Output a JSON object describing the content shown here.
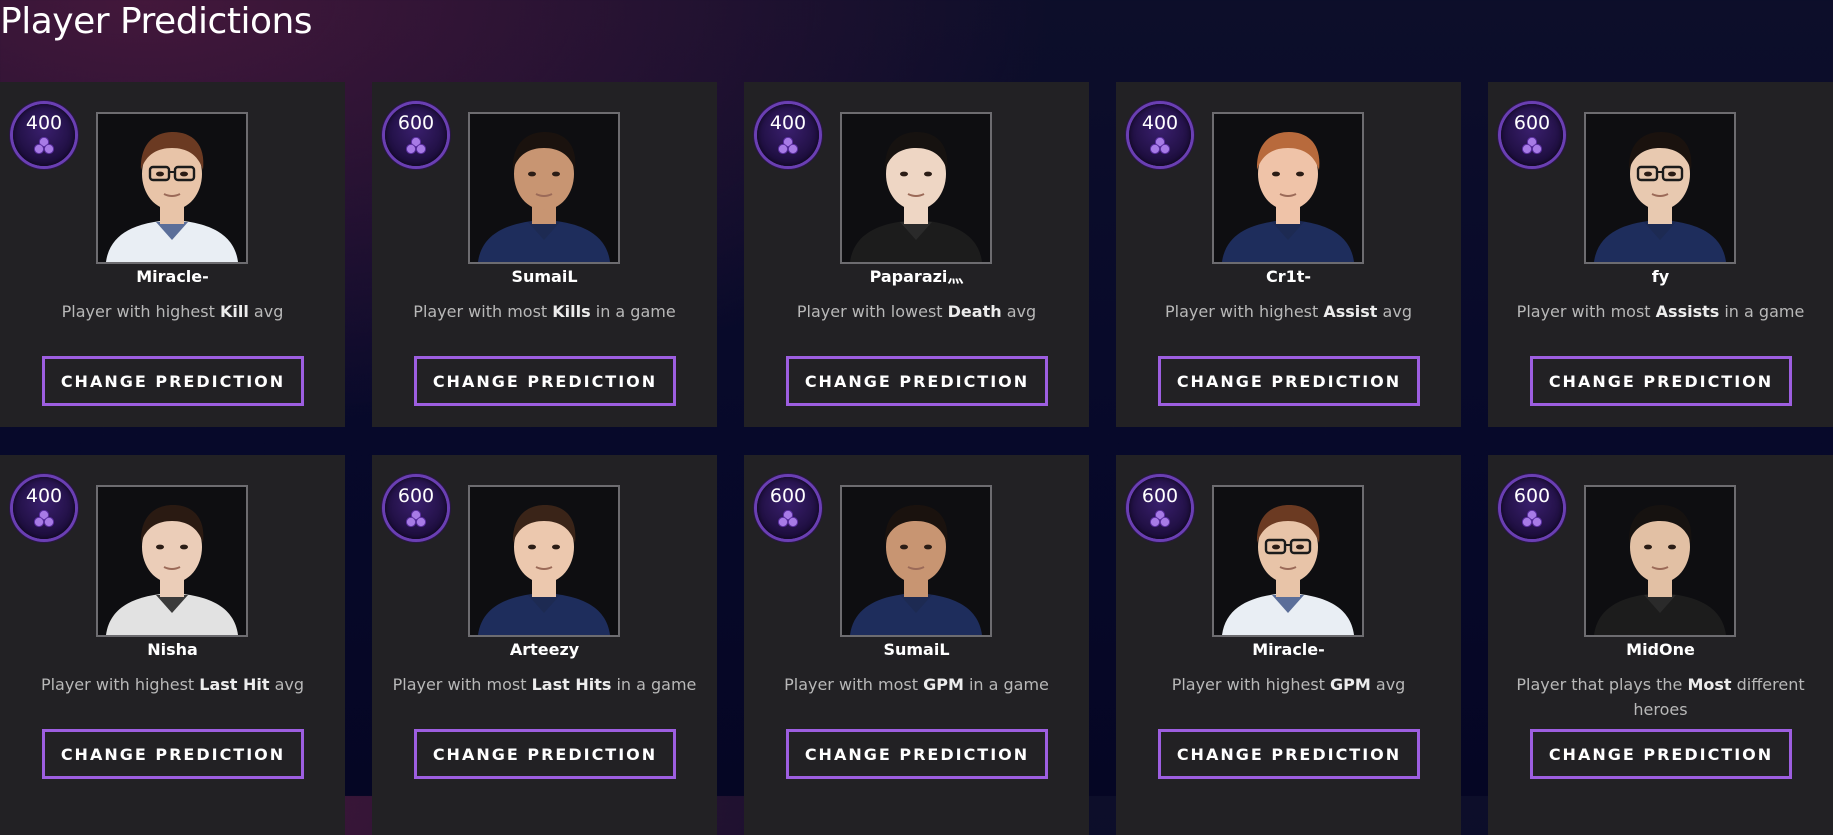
{
  "page": {
    "title": "Player Predictions"
  },
  "colors": {
    "card_bg": "#222124",
    "button_border": "#9d5ee0",
    "badge_ring": "#6a3fb3",
    "badge_fill": "#1d0e3e"
  },
  "icons": {
    "badge": "shard-icon",
    "portrait": "player-portrait"
  },
  "button_label": "CHANGE PREDICTION",
  "cards": [
    {
      "points": "400",
      "player": "Miracle-",
      "desc_pre": "Player with highest ",
      "desc_bold": "Kill",
      "desc_post": " avg",
      "tone": "#5b6e99",
      "hair": "#6b3a22",
      "skin": "#e8c4a8",
      "glasses": true,
      "jersey": "#e9eef4"
    },
    {
      "points": "600",
      "player": "SumaiL",
      "desc_pre": "Player with most ",
      "desc_bold": "Kills",
      "desc_post": " in a game",
      "tone": "#1d2a52",
      "hair": "#1a120e",
      "skin": "#c89572",
      "glasses": false,
      "jersey": "#1e2d5c"
    },
    {
      "points": "400",
      "player": "Paparazi灬",
      "desc_pre": "Player with lowest ",
      "desc_bold": "Death",
      "desc_post": " avg",
      "tone": "#2a2a2a",
      "hair": "#161210",
      "skin": "#eed6c4",
      "glasses": false,
      "jersey": "#1c1c1c"
    },
    {
      "points": "400",
      "player": "Cr1t-",
      "desc_pre": "Player with highest ",
      "desc_bold": "Assist",
      "desc_post": " avg",
      "tone": "#1d2a52",
      "hair": "#b86a3c",
      "skin": "#efc3a8",
      "glasses": false,
      "jersey": "#1e2d5c"
    },
    {
      "points": "600",
      "player": "fy",
      "desc_pre": "Player with most ",
      "desc_bold": "Assists",
      "desc_post": " in a game",
      "tone": "#1d2a52",
      "hair": "#1a120e",
      "skin": "#e8c9b0",
      "glasses": true,
      "jersey": "#1e2d5c"
    },
    {
      "points": "400",
      "player": "Nisha",
      "desc_pre": "Player with highest ",
      "desc_bold": "Last Hit",
      "desc_post": " avg",
      "tone": "#3a3a3a",
      "hair": "#2a1a12",
      "skin": "#ebcdb8",
      "glasses": false,
      "jersey": "#e2e2e2"
    },
    {
      "points": "600",
      "player": "Arteezy",
      "desc_pre": "Player with most ",
      "desc_bold": "Last Hits",
      "desc_post": " in a game",
      "tone": "#1d2a52",
      "hair": "#3a2418",
      "skin": "#ecc8ae",
      "glasses": false,
      "jersey": "#1e2d5c"
    },
    {
      "points": "600",
      "player": "SumaiL",
      "desc_pre": "Player with most ",
      "desc_bold": "GPM",
      "desc_post": " in a game",
      "tone": "#1d2a52",
      "hair": "#1a120e",
      "skin": "#c89572",
      "glasses": false,
      "jersey": "#1e2d5c"
    },
    {
      "points": "600",
      "player": "Miracle-",
      "desc_pre": "Player with highest ",
      "desc_bold": "GPM",
      "desc_post": " avg",
      "tone": "#5b6e99",
      "hair": "#6b3a22",
      "skin": "#e8c4a8",
      "glasses": true,
      "jersey": "#e9eef4"
    },
    {
      "points": "600",
      "player": "MidOne",
      "desc_pre": "Player that plays the ",
      "desc_bold": "Most",
      "desc_post": " different heroes",
      "tone": "#2a2a2a",
      "hair": "#161210",
      "skin": "#e2c0a4",
      "glasses": false,
      "jersey": "#1c1c1c"
    }
  ]
}
